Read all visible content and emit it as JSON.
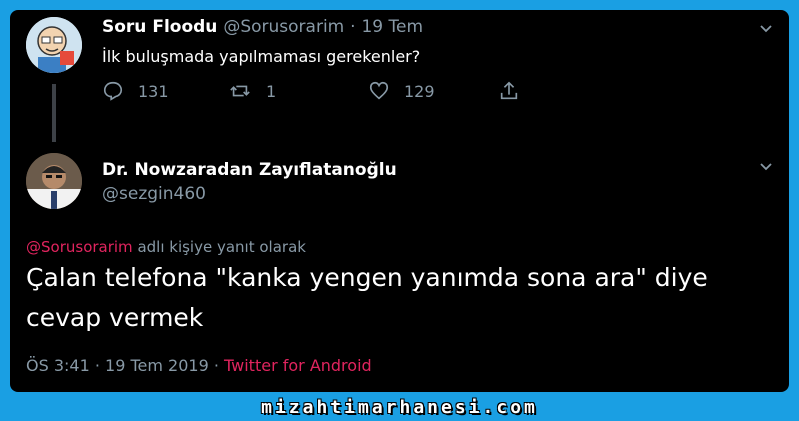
{
  "tweet1": {
    "name": "Soru Floodu",
    "handle": "@Sorusorarim",
    "sep": "·",
    "date": "19 Tem",
    "text": "İlk buluşmada yapılmaması gerekenler?",
    "replies": "131",
    "retweets": "1",
    "likes": "129"
  },
  "tweet2": {
    "name": "Dr. Nowzaradan Zayıflatanoğlu",
    "handle": "@sezgin460",
    "reply_to_handle": "@Sorusorarim",
    "reply_to_suffix": " adlı kişiye yanıt olarak",
    "text": "Çalan telefona \"kanka yengen yanımda sona ara\" diye cevap vermek",
    "timestamp": "ÖS 3:41 · 19 Tem 2019 · ",
    "source": "Twitter for Android"
  },
  "footer": {
    "site": "mizahtimarhanesi.com"
  },
  "colors": {
    "background": "#1a9fe3",
    "card": "#000000",
    "accent_link": "#e0245e",
    "muted": "#8899a6"
  }
}
